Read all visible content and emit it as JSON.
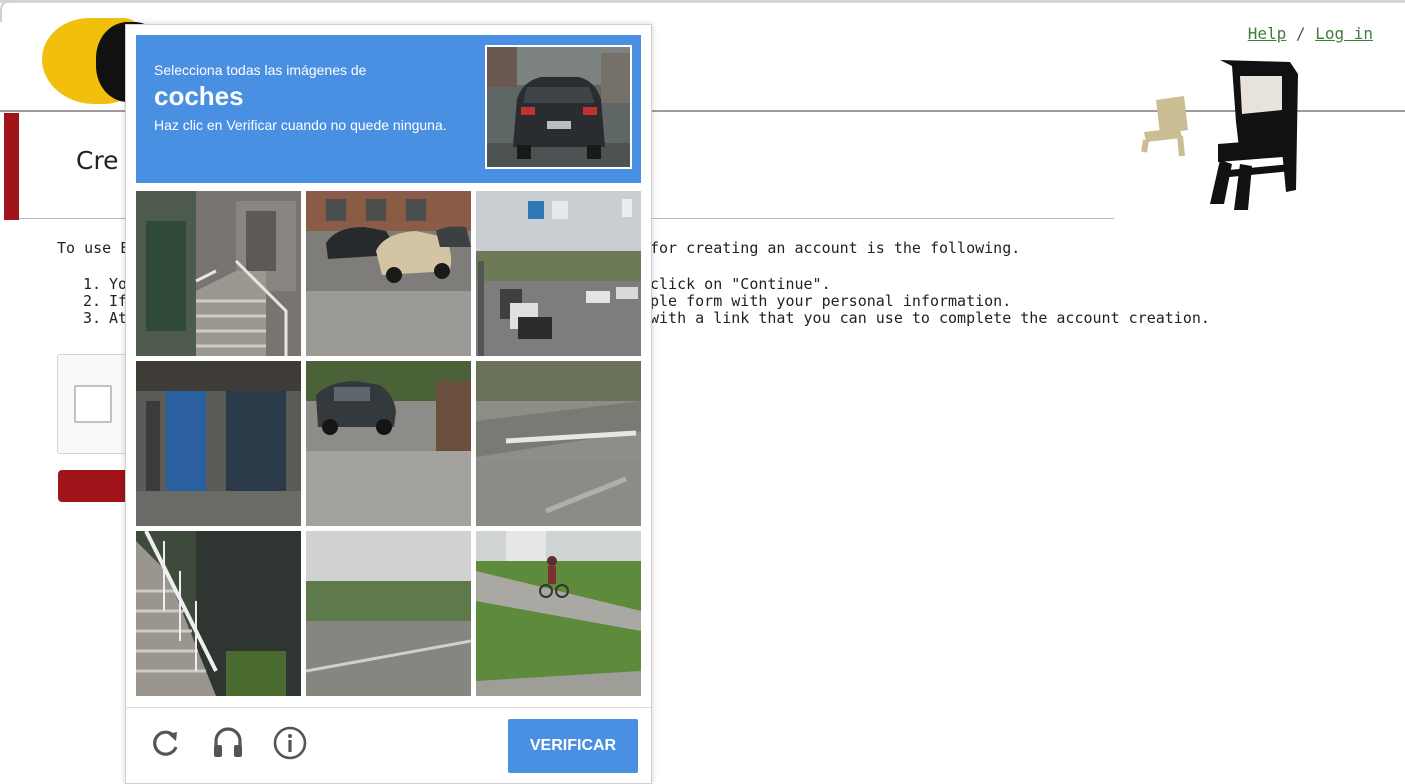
{
  "header": {
    "help_link": "Help",
    "separator": "/",
    "login_link": "Log in"
  },
  "page": {
    "title_visible": "Cre",
    "intro_visible_start": "To use E",
    "intro_visible_end": "for creating an account is the following.",
    "steps": [
      {
        "num": "1.",
        "visible_start": "Yo",
        "visible_end": "click on \"Continue\"."
      },
      {
        "num": "2.",
        "visible_start": "If",
        "visible_end": "ple form with your personal information."
      },
      {
        "num": "3.",
        "visible_start": "At",
        "visible_end": "with a link that you can use to complete the account creation."
      }
    ],
    "accent_color": "#a0141a"
  },
  "captcha": {
    "instruction": "Selecciona todas las imágenes de",
    "target": "coches",
    "hint": "Haz clic en Verificar cuando no quede ninguna.",
    "verify_label": "VERIFICAR",
    "header_color": "#4a90e2",
    "tiles": [
      "building-stairs",
      "parked-cars",
      "street-traffic",
      "storefront",
      "car-on-road",
      "intersection",
      "outdoor-stairs",
      "field-road",
      "cyclist-on-path"
    ],
    "footer_icons": [
      "reload-icon",
      "audio-icon",
      "info-icon"
    ]
  }
}
